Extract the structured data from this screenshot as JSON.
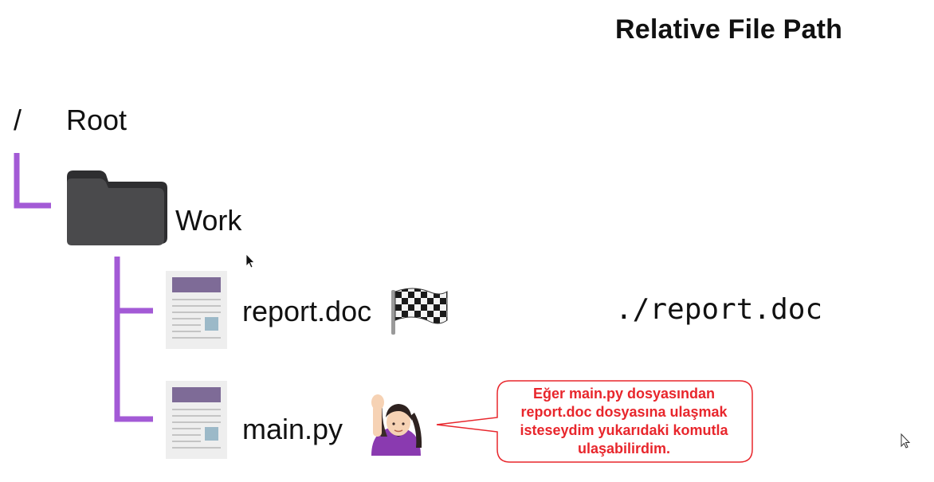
{
  "header": {
    "title": "Relative File Path"
  },
  "tree": {
    "root_symbol": "/",
    "root_label": "Root",
    "folder_label": "Work",
    "files": [
      {
        "label": "report.doc",
        "icon": "document-icon",
        "marker": "checkered-flag-icon"
      },
      {
        "label": "main.py",
        "icon": "document-icon",
        "marker": "person-raising-hand-icon"
      }
    ]
  },
  "path_example": "./report.doc",
  "callout": {
    "text": "Eğer main.py dosyasından report.doc dosyasına ulaşmak isteseydim yukarıdaki komutla ulaşabilirdim."
  },
  "colors": {
    "connector": "#a35ad6",
    "callout": "#e8262c",
    "folder": "#4a4a4c",
    "doc_header": "#7e6b97",
    "doc_image": "#9cb9c8"
  }
}
